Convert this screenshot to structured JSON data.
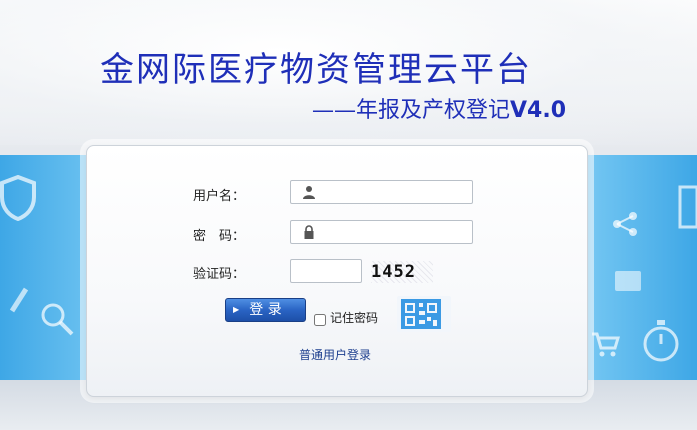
{
  "header": {
    "title": "金网际医疗物资管理云平台",
    "subtitle": "——年报及产权登记",
    "version": "V4.0"
  },
  "login": {
    "username_label": "用户名：",
    "password_label": "密　码：",
    "captcha_label": "验证码：",
    "username_value": "",
    "password_value": "",
    "captcha_value": "",
    "captcha_image_text": "1452",
    "login_button": "登 录",
    "remember_label": "记住密码",
    "remember_checked": false,
    "ordinary_login_link": "普通用户登录"
  },
  "icons": {
    "username_field": "user-icon",
    "password_field": "lock-icon",
    "qr": "qr-code-icon"
  },
  "colors": {
    "title": "#1f2fb8",
    "band": "#3ea7e6",
    "button": "#2a64c4",
    "link": "#1e3f8f"
  }
}
